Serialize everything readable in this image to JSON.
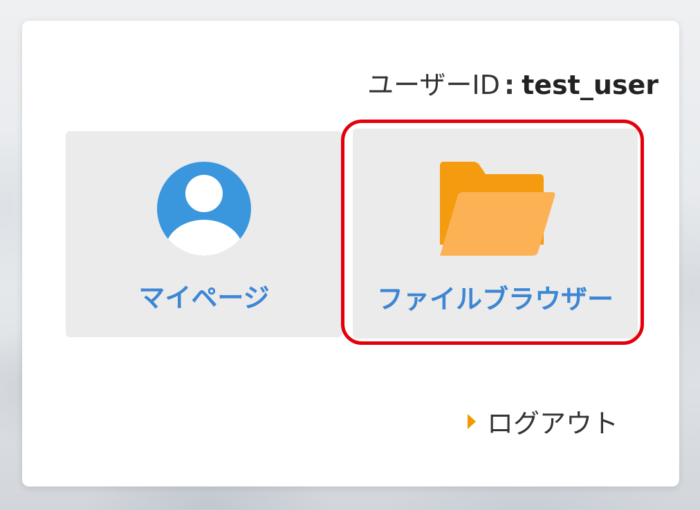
{
  "header": {
    "user_id_label": "ユーザーID",
    "separator": ":",
    "user_id_value": "test_user"
  },
  "tiles": [
    {
      "label": "マイページ",
      "icon": "user-avatar-icon"
    },
    {
      "label": "ファイルブラウザー",
      "icon": "folder-open-icon"
    }
  ],
  "footer": {
    "logout_label": "ログアウト",
    "logout_icon": "triangle-right-icon"
  },
  "colors": {
    "accent_blue": "#3d86d4",
    "avatar_blue": "#3b97dd",
    "folder_dark": "#f49b0f",
    "folder_light": "#fdb155",
    "highlight_red": "#e3000b",
    "arrow_orange": "#f39800",
    "tile_bg": "#ebebeb"
  }
}
